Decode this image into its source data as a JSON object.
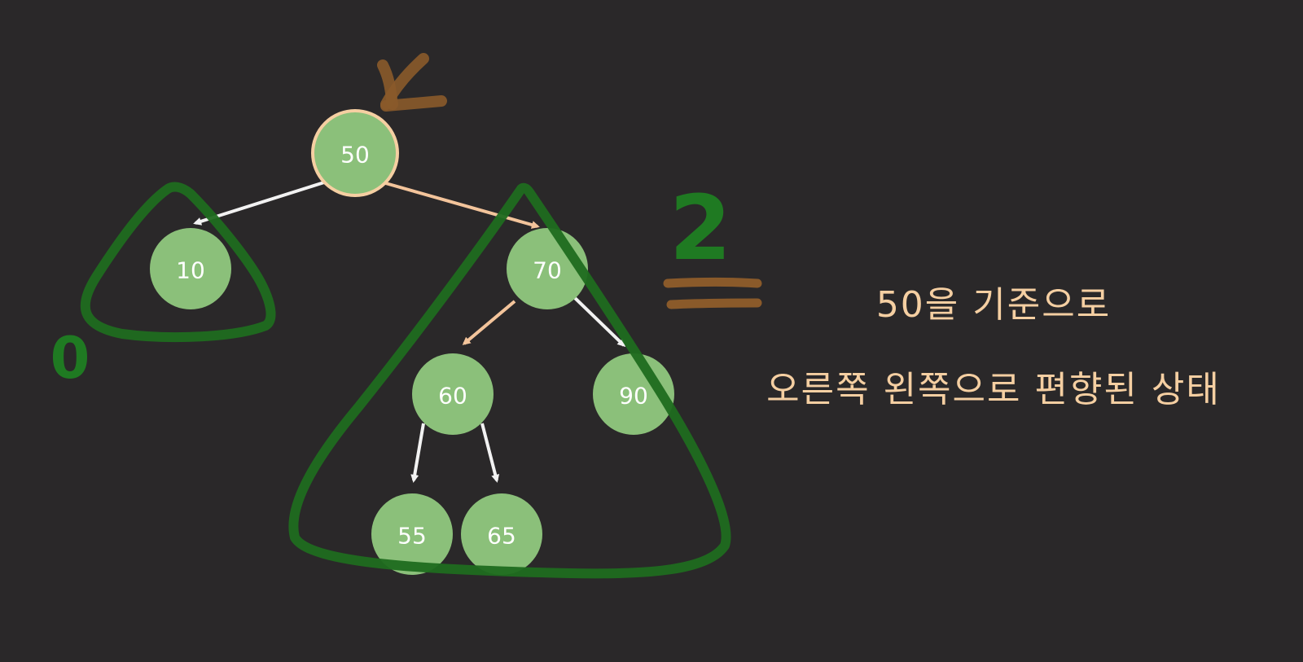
{
  "tree": {
    "nodes": [
      {
        "id": "n50",
        "label": "50",
        "highlight": true
      },
      {
        "id": "n10",
        "label": "10"
      },
      {
        "id": "n70",
        "label": "70"
      },
      {
        "id": "n60",
        "label": "60"
      },
      {
        "id": "n90",
        "label": "90"
      },
      {
        "id": "n55",
        "label": "55"
      },
      {
        "id": "n65",
        "label": "65"
      }
    ]
  },
  "annotations": {
    "left_height": "0",
    "right_height": "2"
  },
  "caption": {
    "line1": "50을 기준으로",
    "line2": "오른쪽 왼쪽으로 편향된 상태"
  },
  "colors": {
    "background": "#2a2829",
    "node_fill": "#8bc07a",
    "node_highlight_stroke": "#f5cfa2",
    "edge_white": "#f2f2f2",
    "edge_peach": "#f3c49b",
    "marker_green": "#1f6b1f",
    "marker_brown": "#8a5a2a",
    "caption": "#f5cfa2"
  }
}
